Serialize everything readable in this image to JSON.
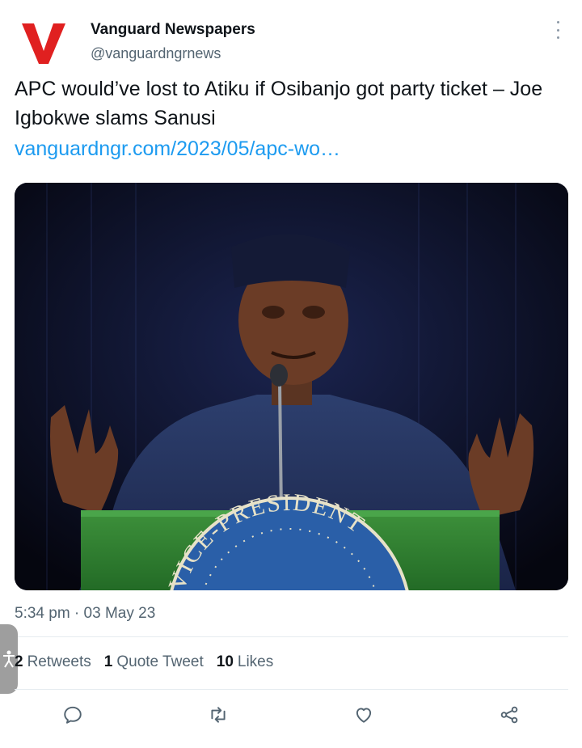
{
  "account": {
    "name": "Vanguard Newspapers",
    "handle": "@vanguardngrnews",
    "logo_letter": "V",
    "logo_color": "#e02020"
  },
  "tweet": {
    "text": "APC would’ve lost to Atiku if Osibanjo got party ticket – Joe Igbokwe slams Sanusi",
    "link": "vanguardngr.com/2023/05/apc-wo…",
    "timestamp": "5:34 pm · 03 May 23"
  },
  "image": {
    "seal_text": "VICE-PRESIDENT"
  },
  "stats": {
    "retweets_count": "2",
    "retweets_label": "Retweets",
    "quotes_count": "1",
    "quotes_label": "Quote Tweet",
    "likes_count": "10",
    "likes_label": "Likes"
  },
  "actions": {
    "icons": [
      "reply-icon",
      "retweet-icon",
      "like-icon",
      "share-icon"
    ]
  },
  "colors": {
    "accent": "#1d9bf0",
    "secondary_text": "#536471",
    "primary_text": "#0f1419"
  }
}
